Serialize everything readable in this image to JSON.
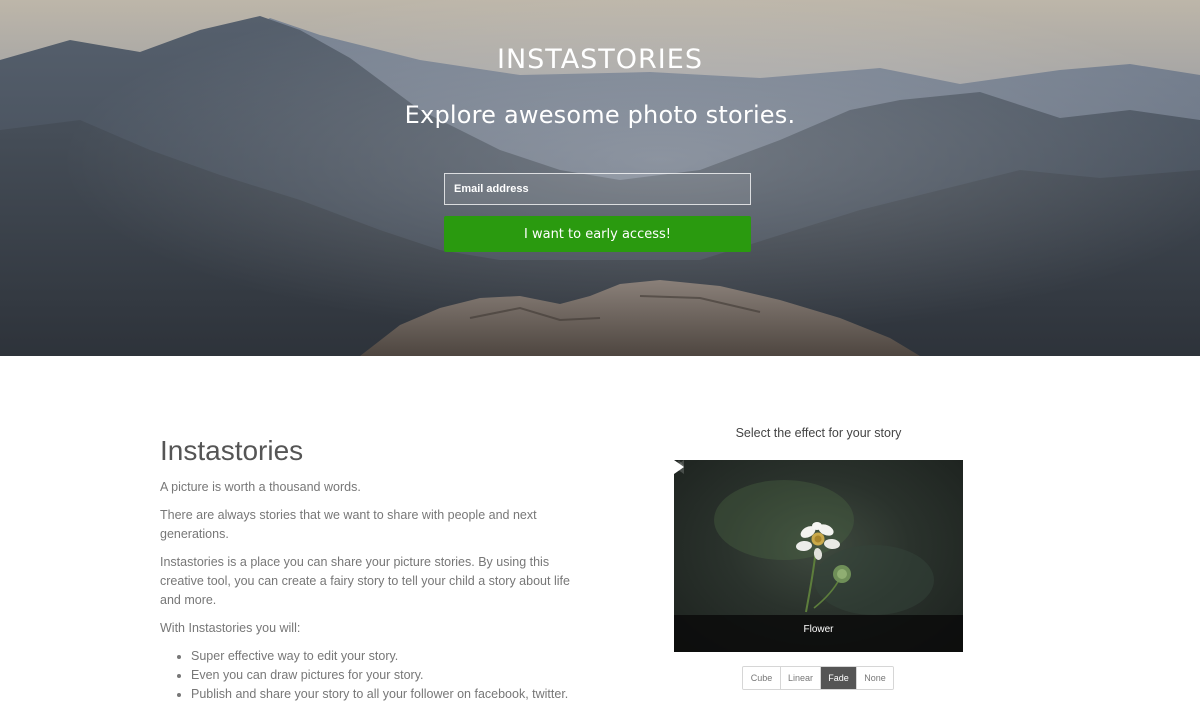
{
  "hero": {
    "logo": "INSTASTORIES",
    "tagline": "Explore awesome photo stories.",
    "email_placeholder": "Email address",
    "cta_label": "I want to early access!"
  },
  "about": {
    "title": "Instastories",
    "paragraphs": [
      "A picture is worth a thousand words.",
      "There are always stories that we want to share with people and next generations.",
      "Instastories is a place you can share your picture stories. By using this creative tool, you can create a fairy story to tell your child a story about life and more.",
      "With Instastories you will:"
    ],
    "features": [
      "Super effective way to edit your story.",
      "Even you can draw pictures for your story.",
      "Publish and share your story to all your follower on facebook, twitter."
    ]
  },
  "effects": {
    "title": "Select the effect for your story",
    "slide_caption": "Flower",
    "options": [
      "Cube",
      "Linear",
      "Fade",
      "None"
    ],
    "active": "Fade"
  },
  "colors": {
    "cta": "#2a9a0f",
    "active_effect": "#555555"
  },
  "icons": {
    "next": "arrow-right-icon",
    "prev": "arrow-left-icon"
  }
}
